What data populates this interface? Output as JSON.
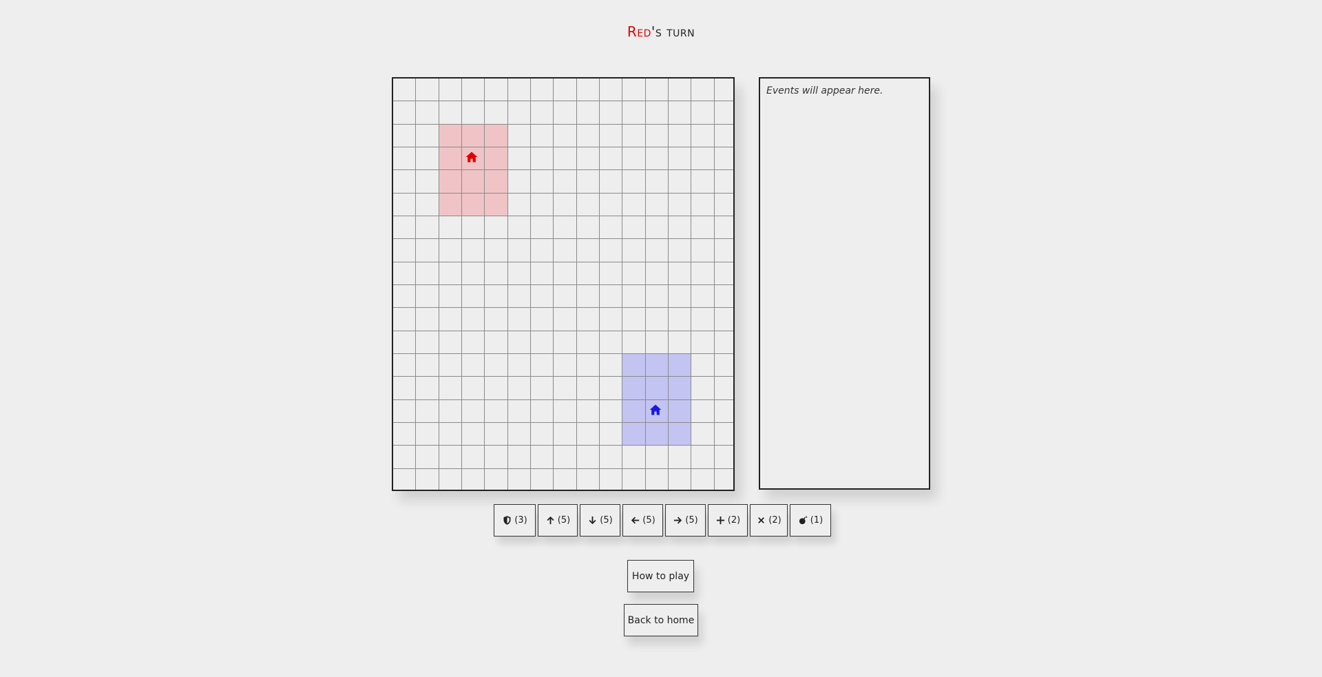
{
  "header": {
    "player": "Red",
    "rest": "'s turn",
    "player_color": "#e00000"
  },
  "board": {
    "columns": 15,
    "rows": 18,
    "red_base": {
      "col_start": 2,
      "col_end": 4,
      "row_start": 2,
      "row_end": 5,
      "color": "#f0c4c6",
      "icon": "home-icon",
      "icon_color": "#e00000"
    },
    "blue_base": {
      "col_start": 10,
      "col_end": 12,
      "row_start": 12,
      "row_end": 15,
      "color": "#c3c4f2",
      "icon": "home-icon",
      "icon_color": "#1a1ae0"
    }
  },
  "events": {
    "placeholder": "Events will appear here."
  },
  "actions": [
    {
      "icon": "shield-icon",
      "count": "(3)"
    },
    {
      "icon": "arrow-up-icon",
      "count": "(5)"
    },
    {
      "icon": "arrow-down-icon",
      "count": "(5)"
    },
    {
      "icon": "arrow-left-icon",
      "count": "(5)"
    },
    {
      "icon": "arrow-right-icon",
      "count": "(5)"
    },
    {
      "icon": "plus-icon",
      "count": "(2)"
    },
    {
      "icon": "x-icon",
      "count": "(2)"
    },
    {
      "icon": "bomb-icon",
      "count": "(1)"
    }
  ],
  "buttons": {
    "how_to_play": "How to play",
    "back_to_home": "Back to home"
  }
}
